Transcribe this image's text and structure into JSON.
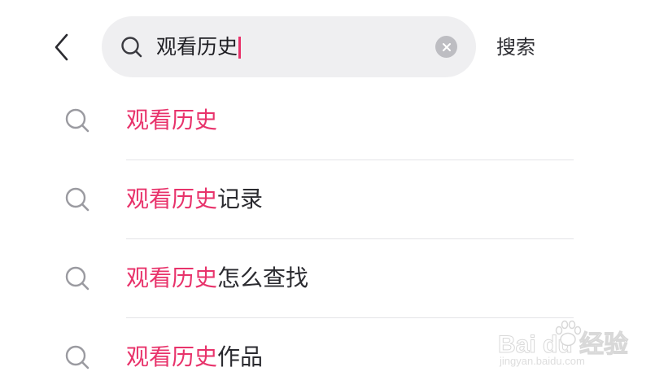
{
  "header": {
    "back_icon": "chevron-left-icon",
    "search": {
      "value": "观看历史",
      "search_icon": "search-icon",
      "clear_icon": "clear-circle-icon"
    },
    "submit_label": "搜索"
  },
  "suggestions": [
    {
      "highlight": "观看历史",
      "rest": ""
    },
    {
      "highlight": "观看历史",
      "rest": "记录"
    },
    {
      "highlight": "观看历史",
      "rest": "怎么查找"
    },
    {
      "highlight": "观看历史",
      "rest": "作品"
    }
  ],
  "watermark": {
    "main": "Bai du 经验",
    "sub": "jingyan.baidu.com"
  },
  "colors": {
    "accent": "#e8336b",
    "search_bg": "#efeff1",
    "text": "#2b2b30",
    "icon_gray": "#9a9aa0"
  }
}
